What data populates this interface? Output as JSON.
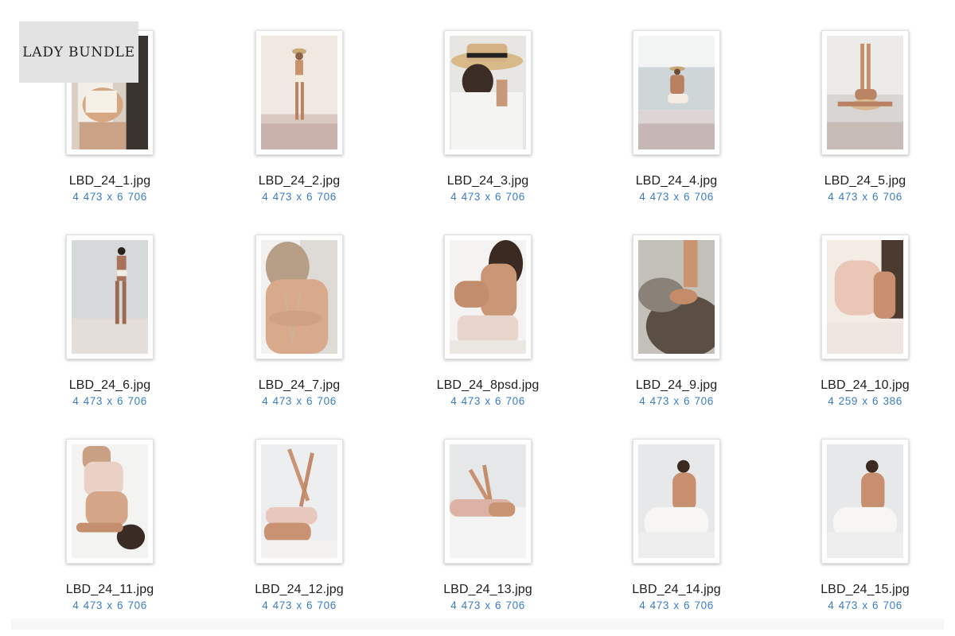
{
  "badge": {
    "text": "LADY BUNDLE"
  },
  "files": [
    {
      "name": "LBD_24_1.jpg",
      "dims": "4 473 x 6 706",
      "scene": "beach-sit"
    },
    {
      "name": "LBD_24_2.jpg",
      "dims": "4 473 x 6 706",
      "scene": "beach-stand"
    },
    {
      "name": "LBD_24_3.jpg",
      "dims": "4 473 x 6 706",
      "scene": "hat-closeup"
    },
    {
      "name": "LBD_24_4.jpg",
      "dims": "4 473 x 6 706",
      "scene": "sea-sit"
    },
    {
      "name": "LBD_24_5.jpg",
      "dims": "4 473 x 6 706",
      "scene": "legs-up-beach"
    },
    {
      "name": "LBD_24_6.jpg",
      "dims": "4 473 x 6 706",
      "scene": "sea-stand"
    },
    {
      "name": "LBD_24_7.jpg",
      "dims": "4 473 x 6 706",
      "scene": "back-hair"
    },
    {
      "name": "LBD_24_8psd.jpg",
      "dims": "4 473 x 6 706",
      "scene": "bed-sit"
    },
    {
      "name": "LBD_24_9.jpg",
      "dims": "4 473 x 6 706",
      "scene": "foot-rock"
    },
    {
      "name": "LBD_24_10.jpg",
      "dims": "4 259 x 6 386",
      "scene": "bed-recline"
    },
    {
      "name": "LBD_24_11.jpg",
      "dims": "4 473 x 6 706",
      "scene": "bed-lying"
    },
    {
      "name": "LBD_24_12.jpg",
      "dims": "4 473 x 6 706",
      "scene": "legs-up-bed"
    },
    {
      "name": "LBD_24_13.jpg",
      "dims": "4 473 x 6 706",
      "scene": "bed-legs"
    },
    {
      "name": "LBD_24_14.jpg",
      "dims": "4 473 x 6 706",
      "scene": "bed-back"
    },
    {
      "name": "LBD_24_15.jpg",
      "dims": "4 473 x 6 706",
      "scene": "bed-back"
    }
  ],
  "colors": {
    "filename": "#1e1e1e",
    "dims": "#3a7cc4",
    "badge_bg": "#e3e3e3"
  }
}
